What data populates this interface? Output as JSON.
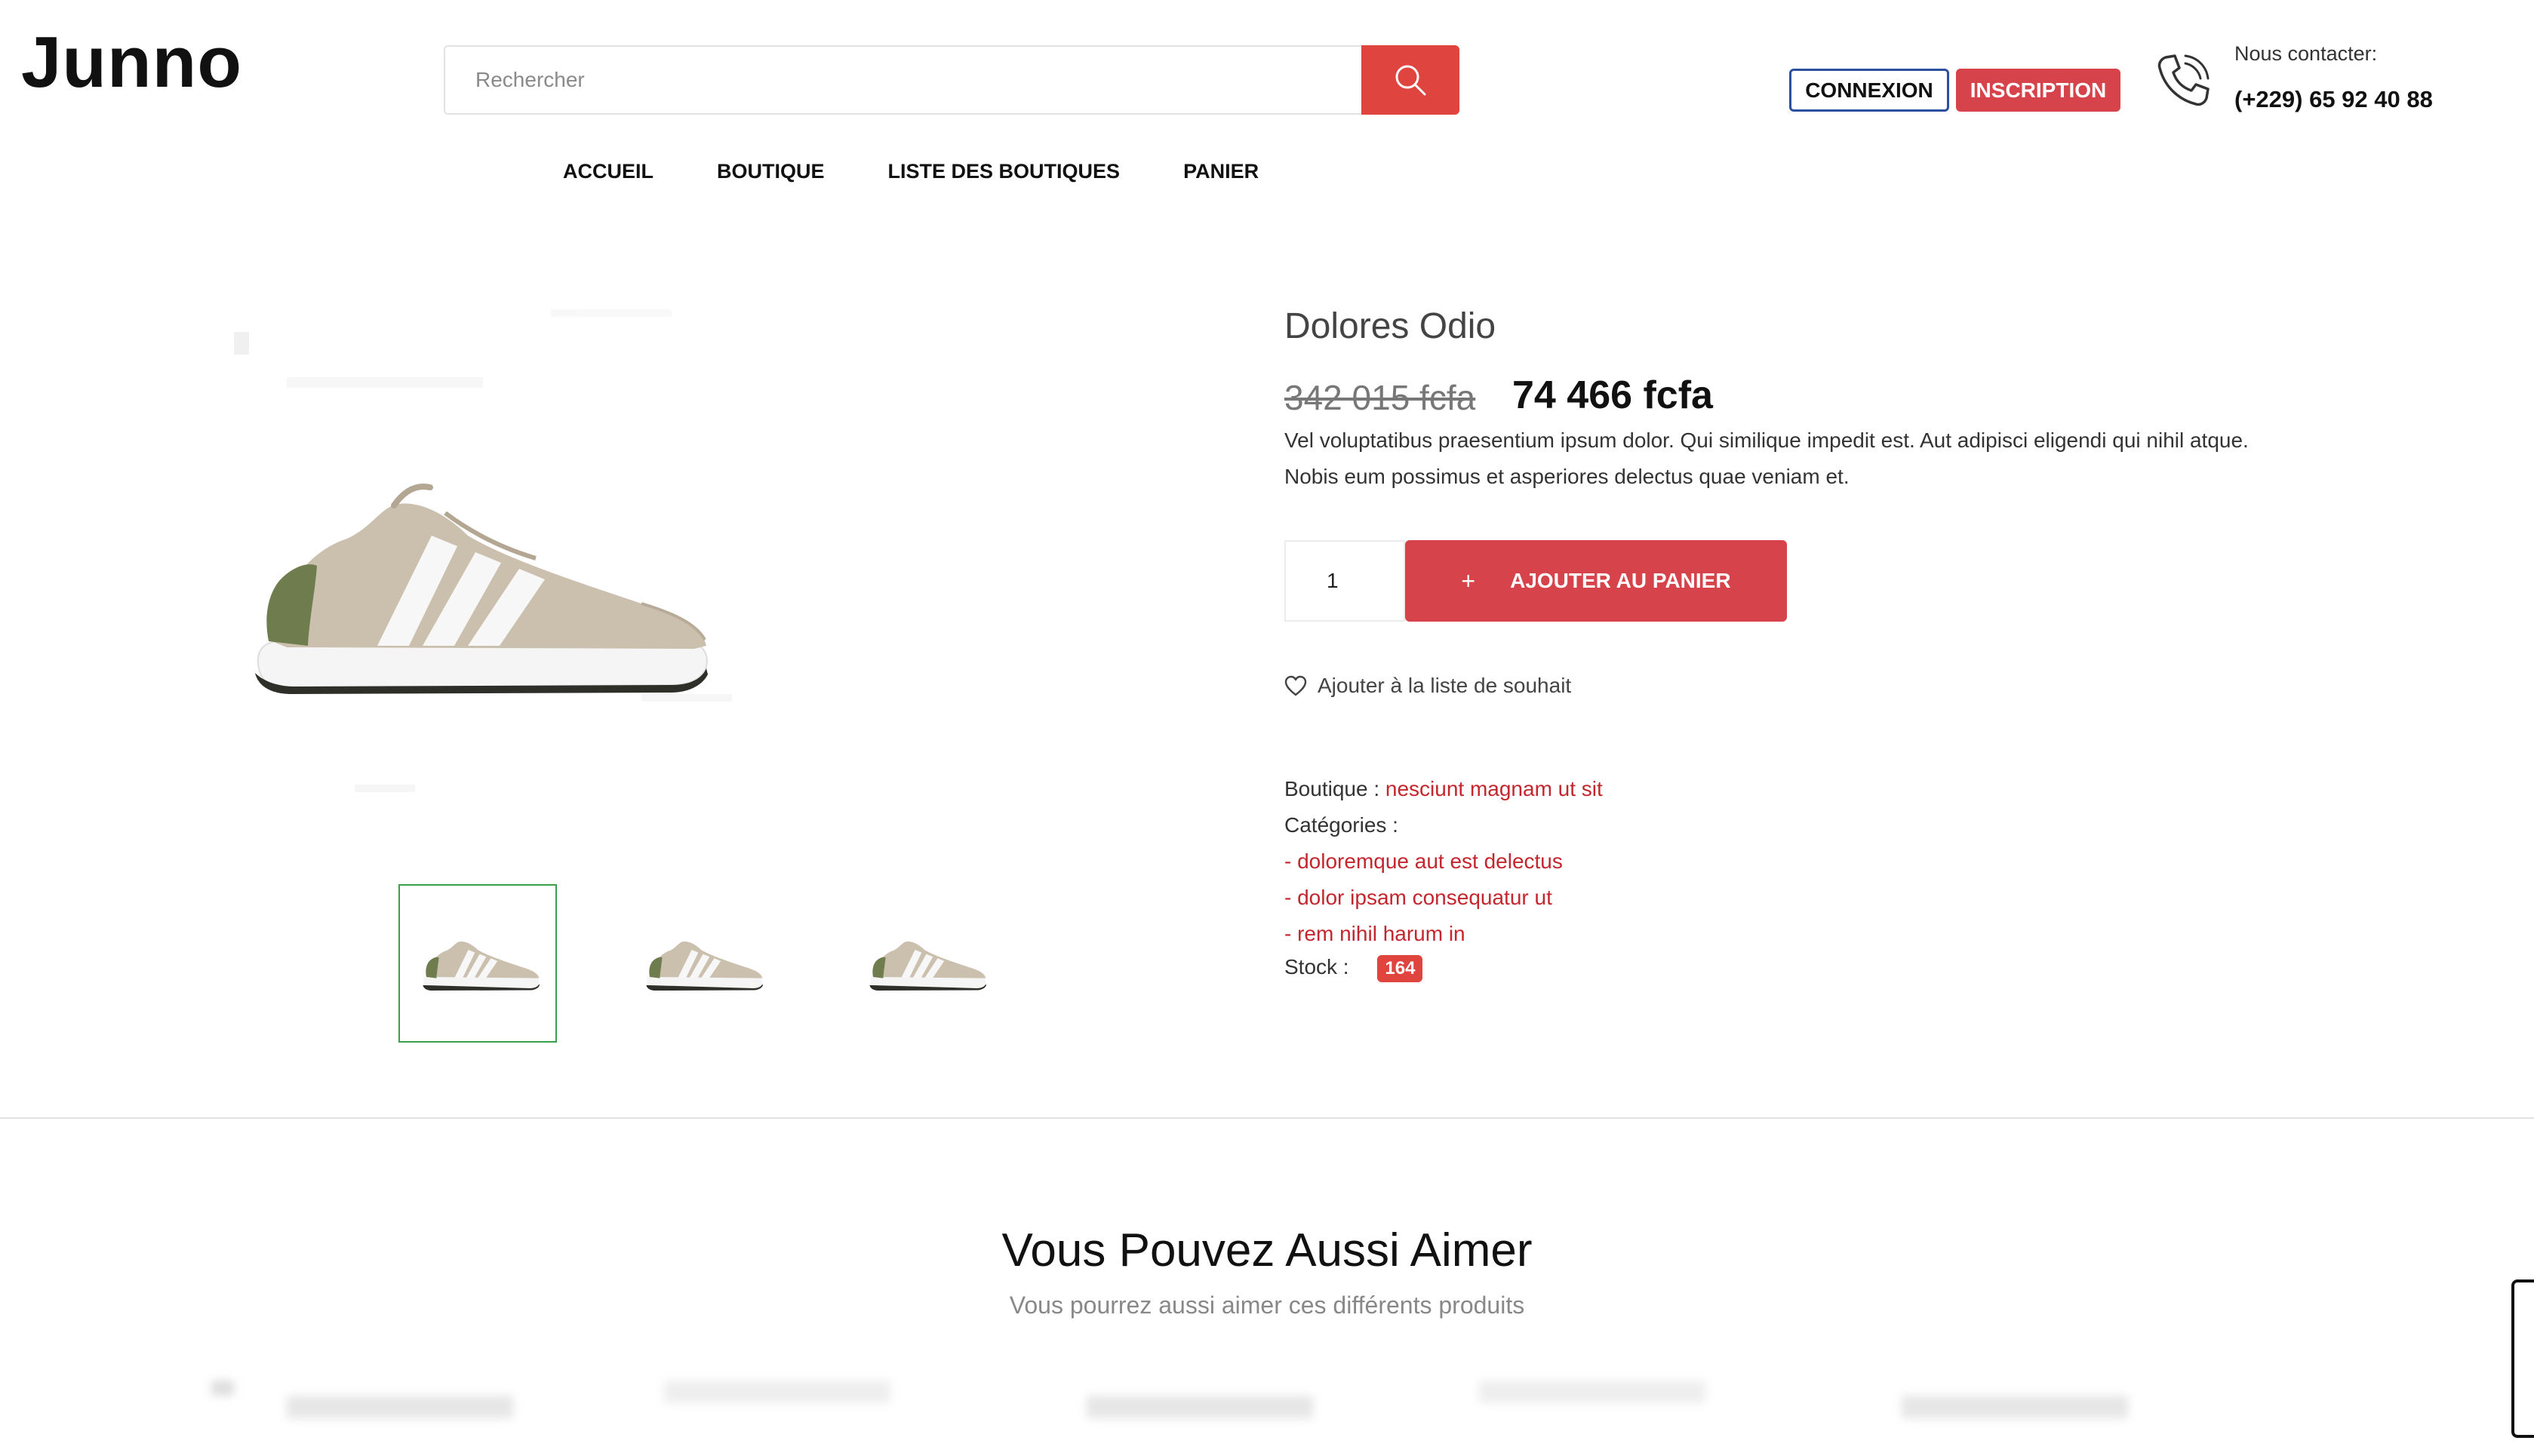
{
  "header": {
    "logo": "Junno",
    "search_placeholder": "Rechercher",
    "login_label": "CONNEXION",
    "signup_label": "INSCRIPTION",
    "contact_label": "Nous contacter:",
    "contact_phone": "(+229) 65 92 40 88"
  },
  "nav": {
    "items": [
      {
        "label": "ACCUEIL"
      },
      {
        "label": "BOUTIQUE"
      },
      {
        "label": "LISTE DES BOUTIQUES"
      },
      {
        "label": "PANIER"
      }
    ]
  },
  "product": {
    "title": "Dolores Odio",
    "old_price": "342 015 fcfa",
    "new_price": "74 466 fcfa",
    "description": "Vel voluptatibus praesentium ipsum dolor. Qui similique impedit est. Aut adipisci eligendi qui nihil atque. Nobis eum possimus et asperiores delectus quae veniam et.",
    "quantity": "1",
    "add_to_cart_label": "AJOUTER AU PANIER",
    "wishlist_label": "Ajouter à la liste de souhait",
    "shop_label": "Boutique :",
    "shop_value": "nesciunt magnam ut sit",
    "categories_label": "Catégories :",
    "categories": [
      "- doloremque aut est delectus",
      "- dolor ipsam consequatur ut",
      "- rem nihil harum in"
    ],
    "stock_label": "Stock :",
    "stock_value": "164"
  },
  "related": {
    "title": "Vous Pouvez Aussi Aimer",
    "subtitle": "Vous pourrez aussi aimer ces différents produits"
  },
  "colors": {
    "accent": "#d7434a",
    "search_button": "#e0443e",
    "link_red": "#c4262e",
    "login_border": "#2c4fa0",
    "thumb_active_border": "#3aa04a"
  },
  "icons": {
    "search": "search-icon",
    "phone": "phone-icon",
    "heart": "heart-icon",
    "plus": "plus-icon"
  }
}
